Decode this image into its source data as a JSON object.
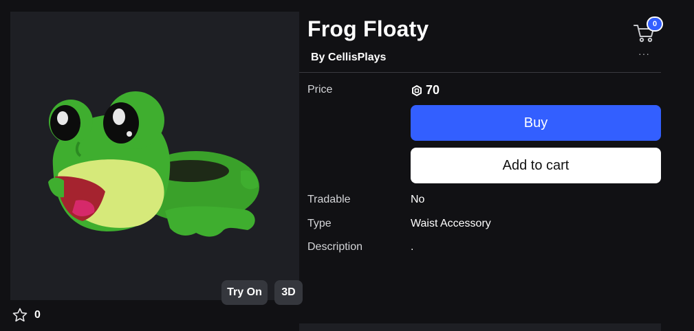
{
  "item": {
    "title": "Frog Floaty",
    "by_prefix": "By",
    "creator": "CellisPlays"
  },
  "header": {
    "cart_count": "0",
    "more_label": "···"
  },
  "preview": {
    "try_on_label": "Try On",
    "view_3d_label": "3D"
  },
  "favorites": {
    "count": "0"
  },
  "details": {
    "price_label": "Price",
    "price_value": "70",
    "buy_label": "Buy",
    "add_to_cart_label": "Add to cart",
    "tradable_label": "Tradable",
    "tradable_value": "No",
    "type_label": "Type",
    "type_value": "Waist Accessory",
    "description_label": "Description",
    "description_value": "."
  },
  "colors": {
    "background": "#111114",
    "panel": "#1e1f24",
    "primary_button": "#335fff",
    "secondary_button": "#ffffff"
  },
  "icons": {
    "cart": "shopping-cart-icon",
    "more": "more-dots-icon",
    "robux": "robux-icon",
    "favorite": "star-outline-icon"
  }
}
